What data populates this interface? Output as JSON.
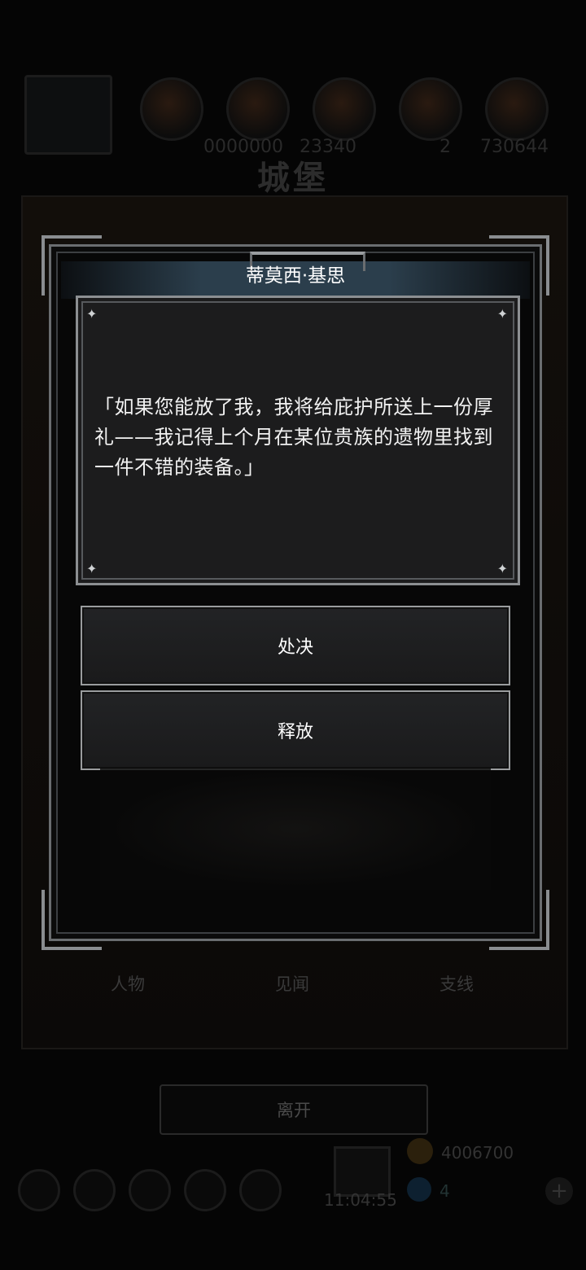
{
  "background": {
    "top_numbers": [
      "0000000",
      "23340",
      "2",
      "730644"
    ],
    "location_title": "城堡",
    "tabs": [
      "人物",
      "见闻",
      "支线"
    ],
    "leave_label": "离开",
    "gold": "4006700",
    "gem": "4",
    "plus": "+",
    "clock": "11:04:55"
  },
  "dialog": {
    "speaker": "蒂莫西·基思",
    "text": "「如果您能放了我，我将给庇护所送上一份厚礼——我记得上个月在某位贵族的遗物里找到一件不错的装备。」",
    "sparkle": "✦",
    "choices": [
      {
        "label": "处决"
      },
      {
        "label": "释放"
      }
    ]
  },
  "colors": {
    "title_bar": "#2b3e4c",
    "text_box_bg": "#1c1c1d",
    "border": "#8c8f92"
  }
}
